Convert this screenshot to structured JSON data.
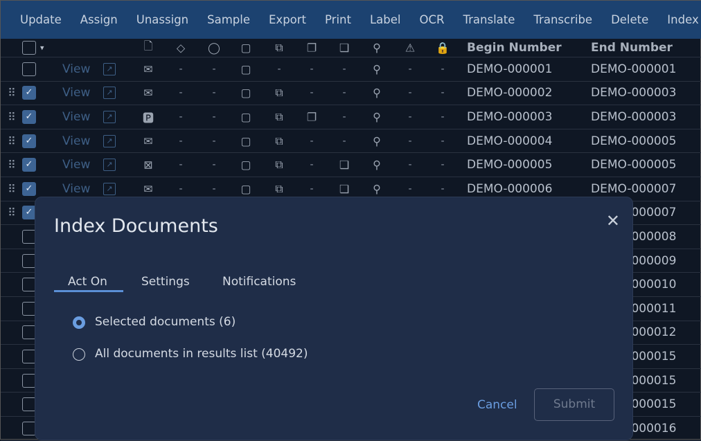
{
  "toolbar": [
    "Update",
    "Assign",
    "Unassign",
    "Sample",
    "Export",
    "Print",
    "Label",
    "OCR",
    "Translate",
    "Transcribe",
    "Delete",
    "Index"
  ],
  "header": {
    "icons": [
      "document-icon",
      "tag-icon",
      "comment-icon",
      "note-icon",
      "email-stack-icon",
      "copies-icon",
      "duplicate-icon",
      "workflow-icon",
      "warning-icon",
      "lock-icon"
    ],
    "begin": "Begin Number",
    "end": "End Number"
  },
  "view_label": "View",
  "rows": [
    {
      "checked": false,
      "drag": false,
      "icons": [
        "email",
        "-",
        "-",
        "note",
        "-",
        "-",
        "-",
        "workflow",
        "-",
        "-"
      ],
      "begin": "DEMO-000001",
      "end": "DEMO-000001"
    },
    {
      "checked": true,
      "drag": true,
      "icons": [
        "email",
        "-",
        "-",
        "note",
        "email-stack",
        "-",
        "-",
        "workflow",
        "-",
        "-"
      ],
      "begin": "DEMO-000002",
      "end": "DEMO-000003"
    },
    {
      "checked": true,
      "drag": true,
      "icons": [
        "pdf",
        "-",
        "-",
        "note",
        "email-stack",
        "copies",
        "-",
        "workflow",
        "-",
        "-"
      ],
      "begin": "DEMO-000003",
      "end": "DEMO-000003"
    },
    {
      "checked": true,
      "drag": true,
      "icons": [
        "email",
        "-",
        "-",
        "note",
        "email-stack",
        "-",
        "-",
        "workflow",
        "-",
        "-"
      ],
      "begin": "DEMO-000004",
      "end": "DEMO-000005"
    },
    {
      "checked": true,
      "drag": true,
      "icons": [
        "excel",
        "-",
        "-",
        "note",
        "email-stack",
        "-",
        "duplicate",
        "workflow",
        "-",
        "-"
      ],
      "begin": "DEMO-000005",
      "end": "DEMO-000005"
    },
    {
      "checked": true,
      "drag": true,
      "icons": [
        "email",
        "-",
        "-",
        "note",
        "email-stack",
        "-",
        "duplicate",
        "workflow",
        "-",
        "-"
      ],
      "begin": "DEMO-000006",
      "end": "DEMO-000007"
    },
    {
      "checked": true,
      "drag": true,
      "icons": [],
      "begin": "",
      "end": "DEMO-000007"
    },
    {
      "checked": false,
      "drag": false,
      "icons": [],
      "begin": "",
      "end": "DEMO-000008"
    },
    {
      "checked": false,
      "drag": false,
      "icons": [],
      "begin": "",
      "end": "DEMO-000009"
    },
    {
      "checked": false,
      "drag": false,
      "icons": [],
      "begin": "",
      "end": "DEMO-000010"
    },
    {
      "checked": false,
      "drag": false,
      "icons": [],
      "begin": "",
      "end": "DEMO-000011"
    },
    {
      "checked": false,
      "drag": false,
      "icons": [],
      "begin": "",
      "end": "DEMO-000012"
    },
    {
      "checked": false,
      "drag": false,
      "icons": [],
      "begin": "",
      "end": "DEMO-000015"
    },
    {
      "checked": false,
      "drag": false,
      "icons": [],
      "begin": "",
      "end": "DEMO-000015"
    },
    {
      "checked": false,
      "drag": false,
      "icons": [],
      "begin": "",
      "end": "DEMO-000015"
    },
    {
      "checked": false,
      "drag": false,
      "icons": [],
      "begin": "",
      "end": "DEMO-000016"
    }
  ],
  "modal": {
    "title": "Index Documents",
    "tabs": [
      "Act On",
      "Settings",
      "Notifications"
    ],
    "active_tab": "Act On",
    "options": [
      {
        "label": "Selected documents (6)",
        "selected": true
      },
      {
        "label": "All documents in results list (40492)",
        "selected": false
      }
    ],
    "cancel": "Cancel",
    "submit": "Submit"
  }
}
